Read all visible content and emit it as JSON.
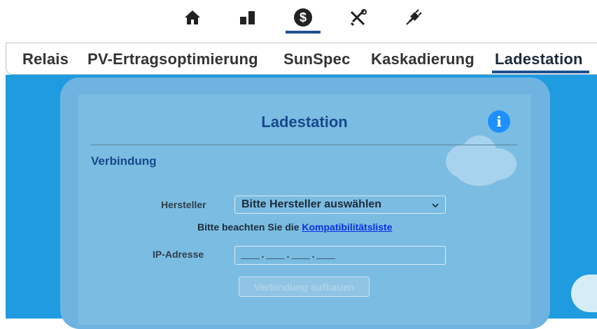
{
  "top_icons": [
    "home-icon",
    "chart-bars-icon",
    "currency-icon",
    "tools-icon",
    "plug-icon"
  ],
  "tabs": [
    {
      "label": "Relais"
    },
    {
      "label": "PV-Ertragsoptimierung"
    },
    {
      "label": "SunSpec"
    },
    {
      "label": "Kaskadierung"
    },
    {
      "label": "Ladestation"
    }
  ],
  "active_tab": "Ladestation",
  "panel": {
    "title": "Ladestation",
    "info_icon_glyph": "i",
    "section_title": "Verbindung",
    "manufacturer": {
      "label": "Hersteller",
      "selected": "Bitte Hersteller auswählen"
    },
    "hint_prefix": "Bitte beachten Sie die",
    "hint_link": "Kompatibilitätsliste",
    "ip": {
      "label": "IP-Adresse",
      "value": "___.___.___.___"
    },
    "connect_button": "Verbindung aufbauen"
  },
  "colors": {
    "accent": "#1e4f91",
    "sky": "#1f9be0",
    "card": "#7bbde2",
    "title": "#17488c",
    "info": "#1e90ff"
  }
}
